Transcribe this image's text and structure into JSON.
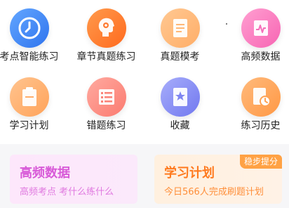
{
  "grid": {
    "items": [
      {
        "label": "考点智能练习",
        "icon": "clock-icon",
        "color": "#3d87f5"
      },
      {
        "label": "章节真题练习",
        "icon": "gear-head-icon",
        "color": "#ff7a2f"
      },
      {
        "label": "真题模考",
        "icon": "document-icon",
        "color": "#ffb877"
      },
      {
        "label": "高频数据",
        "icon": "chart-icon",
        "color": "#f66fb9"
      },
      {
        "label": "学习计划",
        "icon": "clipboard-icon",
        "color": "#ffad6a"
      },
      {
        "label": "错题练习",
        "icon": "list-icon",
        "color": "#fb8378"
      },
      {
        "label": "收藏",
        "icon": "star-book-icon",
        "color": "#7f86f2"
      },
      {
        "label": "练习历史",
        "icon": "history-icon",
        "color": "#ffa355"
      }
    ]
  },
  "cards": {
    "left": {
      "title": "高频数据",
      "desc": "高频考点 考什么练什么"
    },
    "right": {
      "title": "学习计划",
      "desc": "今日566人完成刷题计划",
      "badge": "稳步提分"
    }
  }
}
